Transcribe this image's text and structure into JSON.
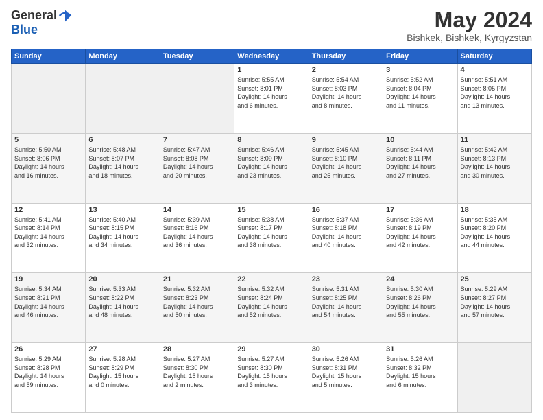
{
  "header": {
    "logo_general": "General",
    "logo_blue": "Blue",
    "month_title": "May 2024",
    "location": "Bishkek, Bishkek, Kyrgyzstan"
  },
  "days_of_week": [
    "Sunday",
    "Monday",
    "Tuesday",
    "Wednesday",
    "Thursday",
    "Friday",
    "Saturday"
  ],
  "weeks": [
    {
      "days": [
        {
          "num": "",
          "info": ""
        },
        {
          "num": "",
          "info": ""
        },
        {
          "num": "",
          "info": ""
        },
        {
          "num": "1",
          "info": "Sunrise: 5:55 AM\nSunset: 8:01 PM\nDaylight: 14 hours\nand 6 minutes."
        },
        {
          "num": "2",
          "info": "Sunrise: 5:54 AM\nSunset: 8:03 PM\nDaylight: 14 hours\nand 8 minutes."
        },
        {
          "num": "3",
          "info": "Sunrise: 5:52 AM\nSunset: 8:04 PM\nDaylight: 14 hours\nand 11 minutes."
        },
        {
          "num": "4",
          "info": "Sunrise: 5:51 AM\nSunset: 8:05 PM\nDaylight: 14 hours\nand 13 minutes."
        }
      ]
    },
    {
      "days": [
        {
          "num": "5",
          "info": "Sunrise: 5:50 AM\nSunset: 8:06 PM\nDaylight: 14 hours\nand 16 minutes."
        },
        {
          "num": "6",
          "info": "Sunrise: 5:48 AM\nSunset: 8:07 PM\nDaylight: 14 hours\nand 18 minutes."
        },
        {
          "num": "7",
          "info": "Sunrise: 5:47 AM\nSunset: 8:08 PM\nDaylight: 14 hours\nand 20 minutes."
        },
        {
          "num": "8",
          "info": "Sunrise: 5:46 AM\nSunset: 8:09 PM\nDaylight: 14 hours\nand 23 minutes."
        },
        {
          "num": "9",
          "info": "Sunrise: 5:45 AM\nSunset: 8:10 PM\nDaylight: 14 hours\nand 25 minutes."
        },
        {
          "num": "10",
          "info": "Sunrise: 5:44 AM\nSunset: 8:11 PM\nDaylight: 14 hours\nand 27 minutes."
        },
        {
          "num": "11",
          "info": "Sunrise: 5:42 AM\nSunset: 8:13 PM\nDaylight: 14 hours\nand 30 minutes."
        }
      ]
    },
    {
      "days": [
        {
          "num": "12",
          "info": "Sunrise: 5:41 AM\nSunset: 8:14 PM\nDaylight: 14 hours\nand 32 minutes."
        },
        {
          "num": "13",
          "info": "Sunrise: 5:40 AM\nSunset: 8:15 PM\nDaylight: 14 hours\nand 34 minutes."
        },
        {
          "num": "14",
          "info": "Sunrise: 5:39 AM\nSunset: 8:16 PM\nDaylight: 14 hours\nand 36 minutes."
        },
        {
          "num": "15",
          "info": "Sunrise: 5:38 AM\nSunset: 8:17 PM\nDaylight: 14 hours\nand 38 minutes."
        },
        {
          "num": "16",
          "info": "Sunrise: 5:37 AM\nSunset: 8:18 PM\nDaylight: 14 hours\nand 40 minutes."
        },
        {
          "num": "17",
          "info": "Sunrise: 5:36 AM\nSunset: 8:19 PM\nDaylight: 14 hours\nand 42 minutes."
        },
        {
          "num": "18",
          "info": "Sunrise: 5:35 AM\nSunset: 8:20 PM\nDaylight: 14 hours\nand 44 minutes."
        }
      ]
    },
    {
      "days": [
        {
          "num": "19",
          "info": "Sunrise: 5:34 AM\nSunset: 8:21 PM\nDaylight: 14 hours\nand 46 minutes."
        },
        {
          "num": "20",
          "info": "Sunrise: 5:33 AM\nSunset: 8:22 PM\nDaylight: 14 hours\nand 48 minutes."
        },
        {
          "num": "21",
          "info": "Sunrise: 5:32 AM\nSunset: 8:23 PM\nDaylight: 14 hours\nand 50 minutes."
        },
        {
          "num": "22",
          "info": "Sunrise: 5:32 AM\nSunset: 8:24 PM\nDaylight: 14 hours\nand 52 minutes."
        },
        {
          "num": "23",
          "info": "Sunrise: 5:31 AM\nSunset: 8:25 PM\nDaylight: 14 hours\nand 54 minutes."
        },
        {
          "num": "24",
          "info": "Sunrise: 5:30 AM\nSunset: 8:26 PM\nDaylight: 14 hours\nand 55 minutes."
        },
        {
          "num": "25",
          "info": "Sunrise: 5:29 AM\nSunset: 8:27 PM\nDaylight: 14 hours\nand 57 minutes."
        }
      ]
    },
    {
      "days": [
        {
          "num": "26",
          "info": "Sunrise: 5:29 AM\nSunset: 8:28 PM\nDaylight: 14 hours\nand 59 minutes."
        },
        {
          "num": "27",
          "info": "Sunrise: 5:28 AM\nSunset: 8:29 PM\nDaylight: 15 hours\nand 0 minutes."
        },
        {
          "num": "28",
          "info": "Sunrise: 5:27 AM\nSunset: 8:30 PM\nDaylight: 15 hours\nand 2 minutes."
        },
        {
          "num": "29",
          "info": "Sunrise: 5:27 AM\nSunset: 8:30 PM\nDaylight: 15 hours\nand 3 minutes."
        },
        {
          "num": "30",
          "info": "Sunrise: 5:26 AM\nSunset: 8:31 PM\nDaylight: 15 hours\nand 5 minutes."
        },
        {
          "num": "31",
          "info": "Sunrise: 5:26 AM\nSunset: 8:32 PM\nDaylight: 15 hours\nand 6 minutes."
        },
        {
          "num": "",
          "info": ""
        }
      ]
    }
  ]
}
